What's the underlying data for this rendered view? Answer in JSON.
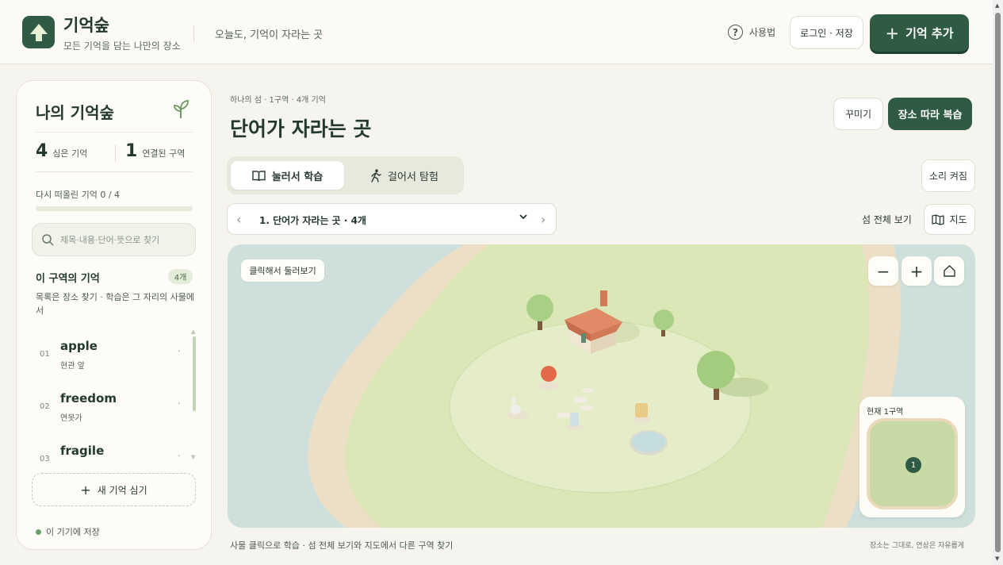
{
  "header": {
    "app_title": "기억숲",
    "app_subtitle": "모든 기억을 담는 나만의 장소",
    "tagline": "오늘도, 기억이 자라는 곳",
    "help_label": "사용법",
    "login_label": "로그인 · 저장",
    "add_label": "기억 추가"
  },
  "sidebar": {
    "title": "나의 기억숲",
    "planted_count": "4",
    "planted_label": "심은 기억",
    "linked_count": "1",
    "linked_label": "연결된 구역",
    "recall_label": "다시 떠올린 기억 0 / 4",
    "recall_progress": 0,
    "search_placeholder": "제목·내용·단어·뜻으로 찾기",
    "section_title": "이 구역의 기억",
    "section_count": "4개",
    "section_desc": "목록은 장소 찾기 · 학습은 그 자리의 사물에서",
    "memories": [
      {
        "num": "01",
        "word": "apple",
        "place": "현관 앞",
        "dot": "·"
      },
      {
        "num": "02",
        "word": "freedom",
        "place": "연못가",
        "dot": "·"
      },
      {
        "num": "03",
        "word": "fragile",
        "place": "",
        "dot": "·"
      }
    ],
    "new_memory_label": "새 기억 심기",
    "saved_label": "이 기기에 저장"
  },
  "main": {
    "breadcrumb": "하나의 섬 · 1구역 · 4개 기억",
    "title": "단어가 자라는 곳",
    "decorate_label": "꾸미기",
    "review_label": "장소 따라 복습",
    "tabs": [
      {
        "label": "눌러서 학습",
        "icon": "book-icon",
        "active": true
      },
      {
        "label": "걸어서 탐험",
        "icon": "walking-icon",
        "active": false
      }
    ],
    "sound_label": "소리 켜짐",
    "zone_select": "1. 단어가 자라는 곳 · 4개",
    "island_view_label": "섬 전체 보기",
    "map_label": "지도",
    "scene_hint": "클릭해서 둘러보기",
    "minimap_label": "현재 1구역",
    "minimap_zone": "1",
    "footer_left": "사물 클릭으로 학습 · 섬 전체 보기와 지도에서 다른 구역 찾기",
    "footer_right": "장소는 그대로, 연상은 자유롭게"
  },
  "colors": {
    "brand": "#2f5a44",
    "water": "#cfe0dc",
    "sand": "#ecdfc5",
    "grass": "#dce7b8",
    "roof": "#e08a68"
  }
}
